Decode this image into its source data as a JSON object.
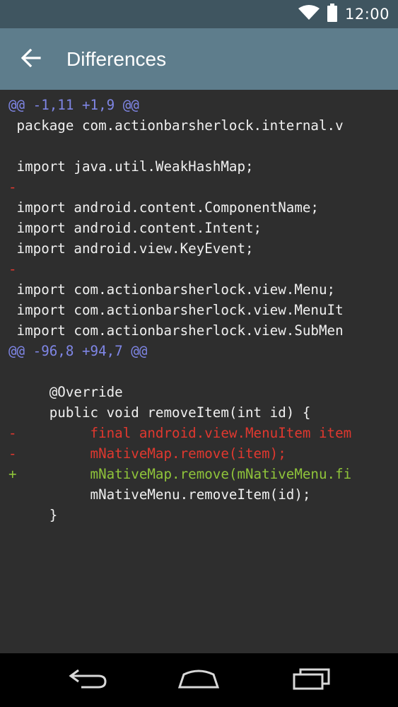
{
  "status_bar": {
    "time": "12:00",
    "icons": [
      "wifi-icon",
      "battery-icon"
    ]
  },
  "app_bar": {
    "title": "Differences",
    "back_icon": "arrow-back-icon"
  },
  "diff": {
    "lines": [
      {
        "type": "hunk",
        "text": "@@ -1,11 +1,9 @@"
      },
      {
        "type": "context",
        "text": " package com.actionbarsherlock.internal.v"
      },
      {
        "type": "context",
        "text": ""
      },
      {
        "type": "context",
        "text": " import java.util.WeakHashMap;"
      },
      {
        "type": "removed",
        "text": "-"
      },
      {
        "type": "context",
        "text": " import android.content.ComponentName;"
      },
      {
        "type": "context",
        "text": " import android.content.Intent;"
      },
      {
        "type": "context",
        "text": " import android.view.KeyEvent;"
      },
      {
        "type": "removed",
        "text": "-"
      },
      {
        "type": "context",
        "text": " import com.actionbarsherlock.view.Menu;"
      },
      {
        "type": "context",
        "text": " import com.actionbarsherlock.view.MenuIt"
      },
      {
        "type": "context",
        "text": " import com.actionbarsherlock.view.SubMen"
      },
      {
        "type": "hunk",
        "text": "@@ -96,8 +94,7 @@"
      },
      {
        "type": "context",
        "text": ""
      },
      {
        "type": "context",
        "text": "     @Override"
      },
      {
        "type": "context",
        "text": "     public void removeItem(int id) {"
      },
      {
        "type": "removed",
        "text": "-         final android.view.MenuItem item"
      },
      {
        "type": "removed",
        "text": "-         mNativeMap.remove(item);"
      },
      {
        "type": "added",
        "text": "+         mNativeMap.remove(mNativeMenu.fi"
      },
      {
        "type": "context",
        "text": "          mNativeMenu.removeItem(id);"
      },
      {
        "type": "context",
        "text": "     }"
      }
    ]
  },
  "nav_bar": {
    "buttons": [
      "back-nav-icon",
      "home-icon",
      "recents-icon"
    ]
  },
  "colors": {
    "status_bar": "#3f5560",
    "app_bar": "#5e7d8c",
    "background": "#2e2e2e",
    "hunk": "#7f86e6",
    "removed": "#e0382f",
    "added": "#8fc43a"
  }
}
